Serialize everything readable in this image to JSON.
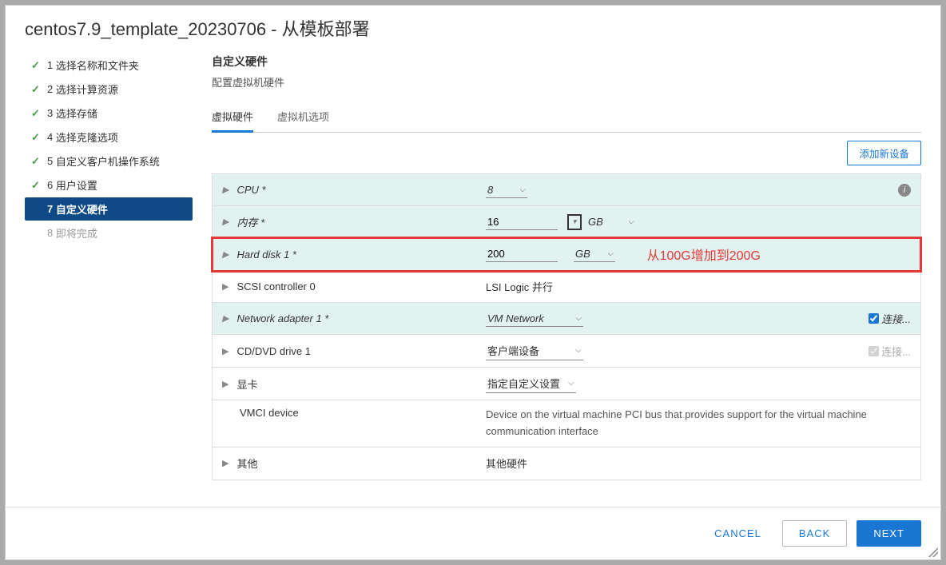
{
  "title": "centos7.9_template_20230706 - 从模板部署",
  "steps": [
    {
      "n": "1",
      "label": "选择名称和文件夹"
    },
    {
      "n": "2",
      "label": "选择计算资源"
    },
    {
      "n": "3",
      "label": "选择存储"
    },
    {
      "n": "4",
      "label": "选择克隆选项"
    },
    {
      "n": "5",
      "label": "自定义客户机操作系统"
    },
    {
      "n": "6",
      "label": "用户设置"
    },
    {
      "n": "7",
      "label": "自定义硬件"
    },
    {
      "n": "8",
      "label": "即将完成"
    }
  ],
  "section": {
    "title": "自定义硬件",
    "sub": "配置虚拟机硬件"
  },
  "tabs": {
    "hw": "虚拟硬件",
    "opt": "虚拟机选项"
  },
  "addDevice": "添加新设备",
  "rows": {
    "cpu": {
      "label": "CPU *",
      "value": "8"
    },
    "mem": {
      "label": "内存 *",
      "value": "16",
      "unit": "GB"
    },
    "hd": {
      "label": "Hard disk 1 *",
      "value": "200",
      "unit": "GB",
      "annot": "从100G增加到200G"
    },
    "scsi": {
      "label": "SCSI controller 0",
      "value": "LSI Logic 并行"
    },
    "net": {
      "label": "Network adapter 1 *",
      "value": "VM Network",
      "connect": "连接..."
    },
    "cd": {
      "label": "CD/DVD drive 1",
      "value": "客户端设备",
      "connect": "连接..."
    },
    "vga": {
      "label": "显卡",
      "value": "指定自定义设置"
    },
    "vmci": {
      "label": "VMCI device",
      "value": "Device on the virtual machine PCI bus that provides support for the virtual machine communication interface"
    },
    "other": {
      "label": "其他",
      "value": "其他硬件"
    }
  },
  "footer": {
    "cancel": "CANCEL",
    "back": "BACK",
    "next": "NEXT"
  }
}
